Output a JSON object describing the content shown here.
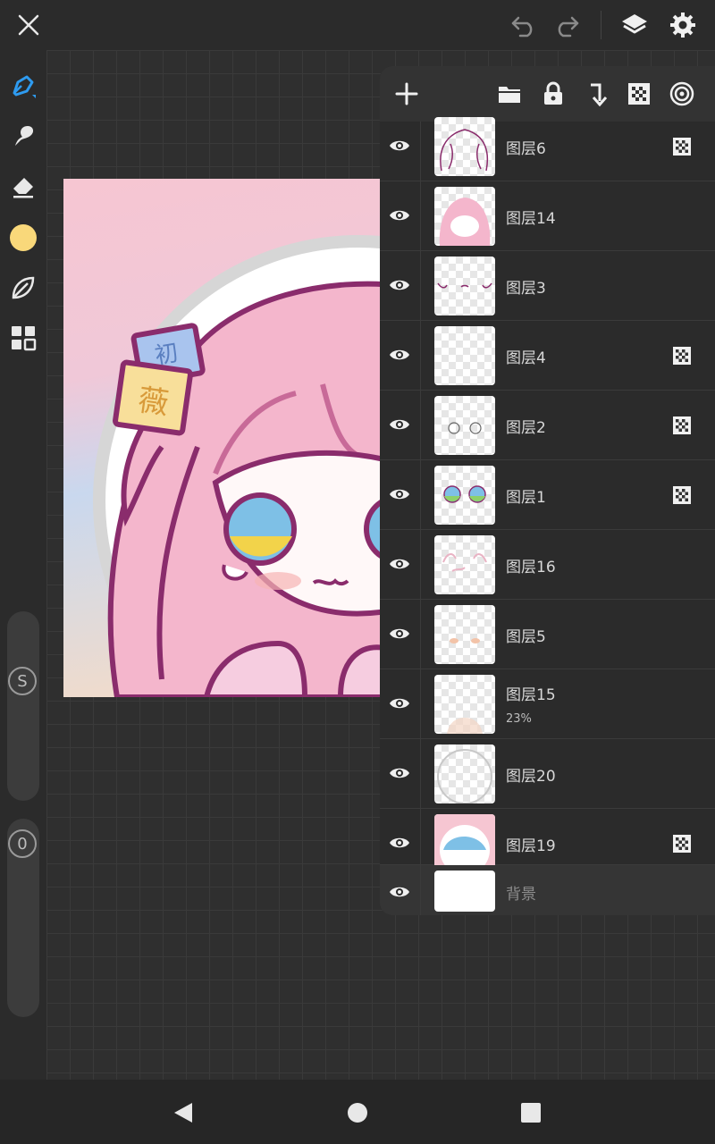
{
  "topbar": {
    "close_icon": "close-icon",
    "undo_icon": "undo-icon",
    "redo_icon": "redo-icon",
    "layers_icon": "layers-icon",
    "settings_icon": "gear-icon"
  },
  "left_tools": {
    "items": [
      "brush-icon",
      "smudge-icon",
      "eraser-icon",
      "color-swatch",
      "leaf-icon",
      "grid-icon"
    ],
    "current_color": "#f9d87a",
    "accent_color": "#2e9bf0",
    "size_slider_label": "S",
    "opacity_slider_label": "0"
  },
  "layers_panel": {
    "toolbar": [
      "add-layer-icon",
      "folder-icon",
      "lock-icon",
      "merge-down-icon",
      "alpha-lock-icon",
      "blend-icon"
    ],
    "layers": [
      {
        "name": "图层6",
        "opacity": "",
        "alpha_locked": true
      },
      {
        "name": "图层14",
        "opacity": "",
        "alpha_locked": false
      },
      {
        "name": "图层3",
        "opacity": "",
        "alpha_locked": false
      },
      {
        "name": "图层4",
        "opacity": "",
        "alpha_locked": true
      },
      {
        "name": "图层2",
        "opacity": "",
        "alpha_locked": true
      },
      {
        "name": "图层1",
        "opacity": "",
        "alpha_locked": true
      },
      {
        "name": "图层16",
        "opacity": "",
        "alpha_locked": false
      },
      {
        "name": "图层5",
        "opacity": "",
        "alpha_locked": false
      },
      {
        "name": "图层15",
        "opacity": "23%",
        "alpha_locked": false
      },
      {
        "name": "图层20",
        "opacity": "",
        "alpha_locked": false
      },
      {
        "name": "图层19",
        "opacity": "",
        "alpha_locked": true
      }
    ],
    "background_layer": {
      "name": "背景"
    }
  },
  "artwork": {
    "sticker_text_1": "初",
    "sticker_text_2": "薇"
  },
  "navbar": {
    "back_icon": "back-icon",
    "home_icon": "home-icon",
    "recents_icon": "recents-icon"
  }
}
